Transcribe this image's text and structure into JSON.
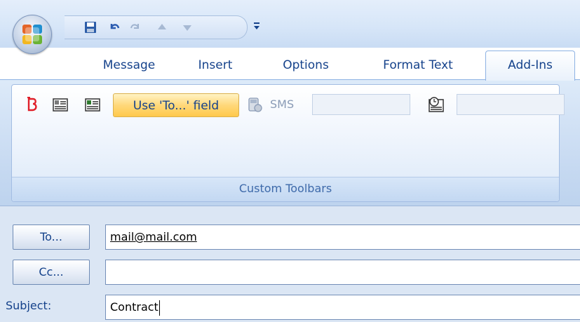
{
  "tabs": [
    "Message",
    "Insert",
    "Options",
    "Format Text",
    "Add-Ins"
  ],
  "active_tab": "Add-Ins",
  "ribbon": {
    "use_to_label": "Use 'To...' field",
    "sms_label": "SMS",
    "group_label": "Custom Toolbars"
  },
  "form": {
    "to_label": "To...",
    "to_value": "mail@mail.com",
    "cc_label": "Cc...",
    "cc_value": "",
    "subject_label": "Subject:",
    "subject_value": "Contract"
  },
  "icons": {
    "office": "office-logo-icon",
    "save": "save-icon",
    "undo": "undo-icon",
    "redo": "redo-icon",
    "up": "previous-item-icon",
    "down": "next-item-icon",
    "customize": "customize-qat-icon",
    "toolbar1": "red-b-icon",
    "toolbar2": "grid-card-icon",
    "toolbar3": "grid-card-add-icon",
    "toolbar4": "sms-phone-icon",
    "toolbar5": "clock-card-icon"
  },
  "colors": {
    "accent": "#15428b",
    "highlight": "#ffd87a",
    "ribbon": "#c6d9f1"
  }
}
